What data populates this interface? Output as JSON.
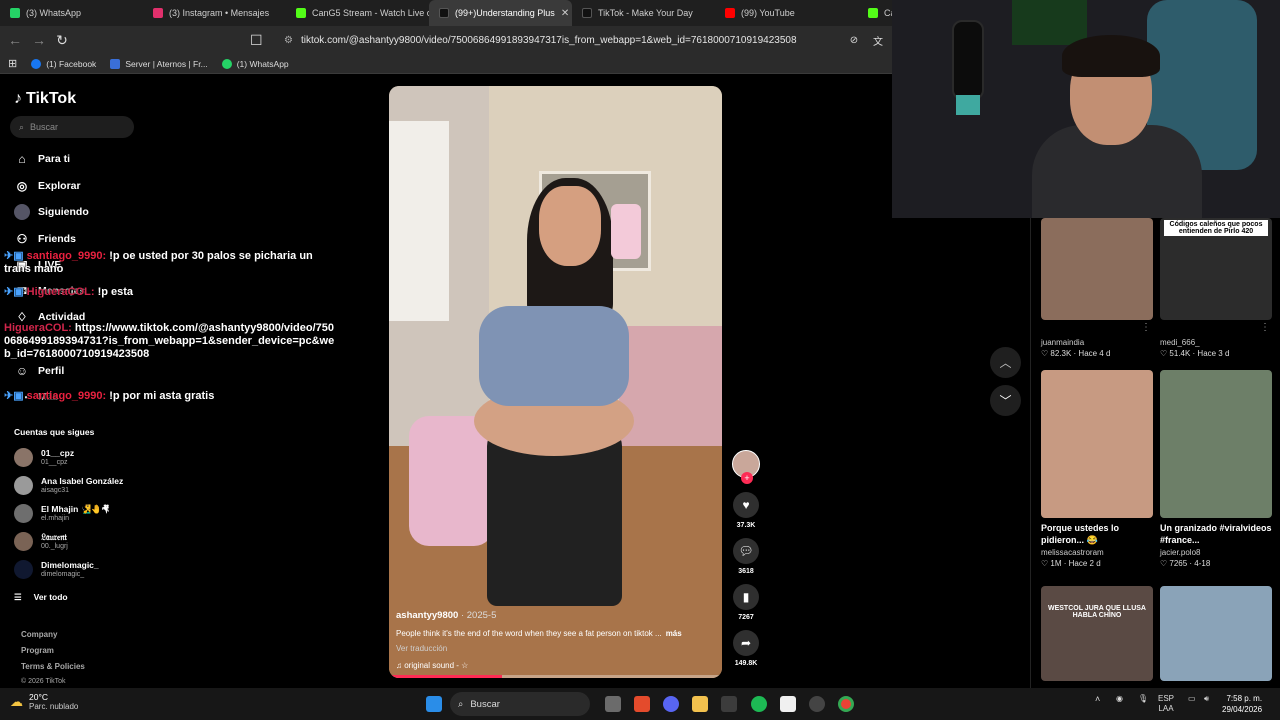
{
  "browser": {
    "tabs": [
      {
        "label": "(3) WhatsApp",
        "color": "#25d366"
      },
      {
        "label": "(3) Instagram • Mensajes",
        "color": "#e1306c"
      },
      {
        "label": "CanG5 Stream - Watch Live on",
        "color": "#53fc18"
      },
      {
        "label": "(99+)Understanding Plus",
        "color": "#111111"
      },
      {
        "label": "TikTok - Make Your Day",
        "color": "#111111"
      },
      {
        "label": "(99) YouTube",
        "color": "#ff0000"
      },
      {
        "label": "Ca",
        "color": "#53fc18"
      }
    ],
    "url": "tiktok.com/@ashantyy9800/video/75006864991893947317is_from_webapp=1&web_id=7618000710919423508",
    "bookmarks": [
      "(1) Facebook",
      "Server | Aternos | Fr...",
      "(1) WhatsApp"
    ]
  },
  "tiktok": {
    "logo": "TikTok",
    "search_placeholder": "Buscar",
    "nav": [
      {
        "label": "Para ti",
        "icon": "home-icon"
      },
      {
        "label": "Explorar",
        "icon": "compass-icon"
      },
      {
        "label": "Siguiendo",
        "icon": "following-icon"
      },
      {
        "label": "Friends",
        "icon": "friends-icon"
      },
      {
        "label": "LIVE",
        "icon": "live-icon"
      },
      {
        "label": "Mensajes",
        "icon": "message-icon"
      },
      {
        "label": "Actividad",
        "icon": "activity-icon"
      },
      {
        "label": "Perfil",
        "icon": "profile-icon"
      },
      {
        "label": "Más",
        "icon": "more-icon"
      }
    ],
    "following_title": "Cuentas que sigues",
    "following": [
      {
        "name": "01__cpz",
        "handle": "01__cpz"
      },
      {
        "name": "Ana Isabel González",
        "handle": "aisagc31"
      },
      {
        "name": "El Mhajin 🧏‍♂️🤚🤻",
        "handle": "el.mhajin"
      },
      {
        "name": "𝔏𝔞𝔲𝔯𝔢𝔫𝔱",
        "handle": "00._lugrj"
      },
      {
        "name": "Dimelomagic_",
        "handle": "dimelomagic_"
      }
    ],
    "see_all": "Ver todo",
    "footer": [
      "Company",
      "Program",
      "Terms & Policies",
      "© 2026 TikTok"
    ]
  },
  "chat": [
    {
      "user": "santiago_9990:",
      "text": " !p oe usted por 30 palos se picharia un trans mano"
    },
    {
      "user": "HigueraCOL:",
      "text": " !p esta"
    },
    {
      "user": "HigueraCOL:",
      "text": " https://www.tiktok.com/@ashantyy9800/video/7500686499189394731?is_from_webapp=1&sender_device=pc&web_id=7618000710919423508"
    },
    {
      "user": "santiago_9990:",
      "text": " !p por mi asta gratis"
    }
  ],
  "video": {
    "username": "ashantyy9800",
    "date": " · 2025-5",
    "caption": "People think it's the end of the word when they see a fat person on tiktok ...",
    "more": "más",
    "translate": "Ver traducción",
    "sound": "♫  original sound - ☆",
    "progress": 0.34,
    "likes": "37.3K",
    "comments": "3618",
    "saves": "7267",
    "shares": "149.8K"
  },
  "right_cards": [
    {
      "title": "",
      "user": "juanmaindia",
      "stats": "♡ 82.3K · Hace 4 d"
    },
    {
      "title": "",
      "overlay": "Códigos caleños que pocos entienden de Pirlo 420",
      "user": "medi_666_",
      "stats": "♡ 51.4K · Hace 3 d"
    },
    {
      "title": "Porque ustedes lo pidieron... 😂",
      "user": "melissacastroram",
      "stats": "♡ 1M · Hace 2 d"
    },
    {
      "title": "Un granizado #viralvideos #france...",
      "user": "jacier.polo8",
      "stats": "♡ 7265 · 4-18"
    },
    {
      "title": "",
      "overlay": "WESTCOL JURA QUE LLUSA HABLA CHINO",
      "user": "",
      "stats": ""
    },
    {
      "title": "",
      "user": "",
      "stats": ""
    }
  ],
  "taskbar": {
    "temp": "20°C",
    "weather": "Parc. nublado",
    "search": "Buscar",
    "lang": "ESP",
    "lang2": "LAA",
    "time": "7:58 p. m.",
    "date": "29/04/2026"
  }
}
